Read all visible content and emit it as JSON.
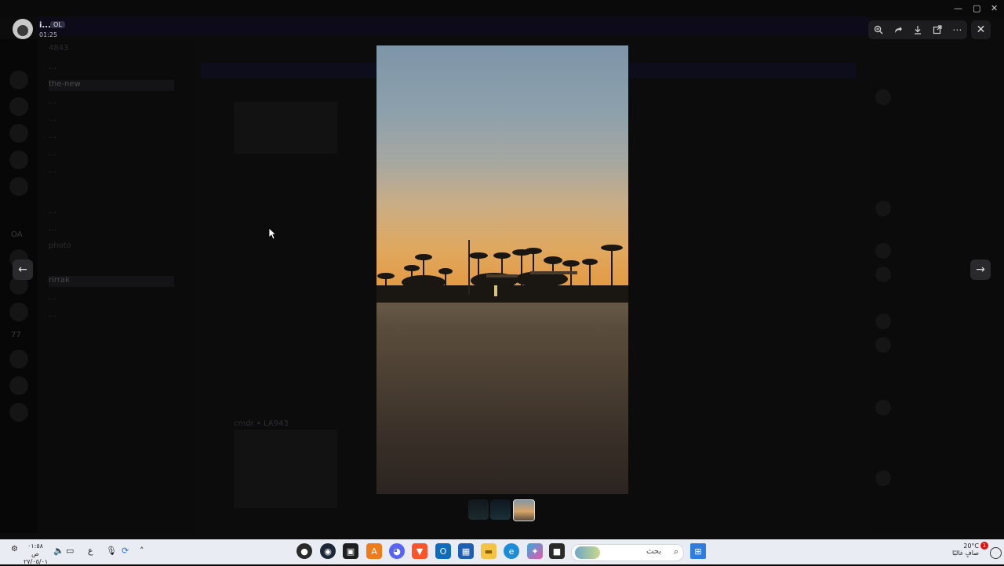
{
  "viewer": {
    "user_name": "i...",
    "user_tag": "OL",
    "timestamp": "01:25",
    "toolbar": [
      "zoom-in",
      "forward",
      "download",
      "open-in-browser",
      "more"
    ],
    "close_label": "✕"
  },
  "background_text": {
    "server_name": "4843",
    "guild_label_a": "OA",
    "guild_label_b": "77",
    "channels": [
      "…",
      "the-new",
      "…",
      "…",
      "…",
      "…",
      "…",
      "…",
      "…",
      "…",
      "photo",
      "…",
      "rirrak",
      "…",
      "…"
    ],
    "chat_author": "cmdr • LA943"
  },
  "thumbnails": [
    "video-1",
    "video-2",
    "sunset-photo"
  ],
  "taskbar": {
    "time": "٠١:٥٨ ص",
    "date": "٢٧/٠٥/٠١",
    "lang": "ع",
    "search_label": "بحث",
    "weather_temp": "20°C",
    "weather_desc": "صافٍ غالبًا",
    "notification_count": "1"
  },
  "colors": {
    "accent": "#5865f2",
    "taskbar_bg": "#e9ecf3",
    "overlay_bg": "#0a0a0b"
  }
}
